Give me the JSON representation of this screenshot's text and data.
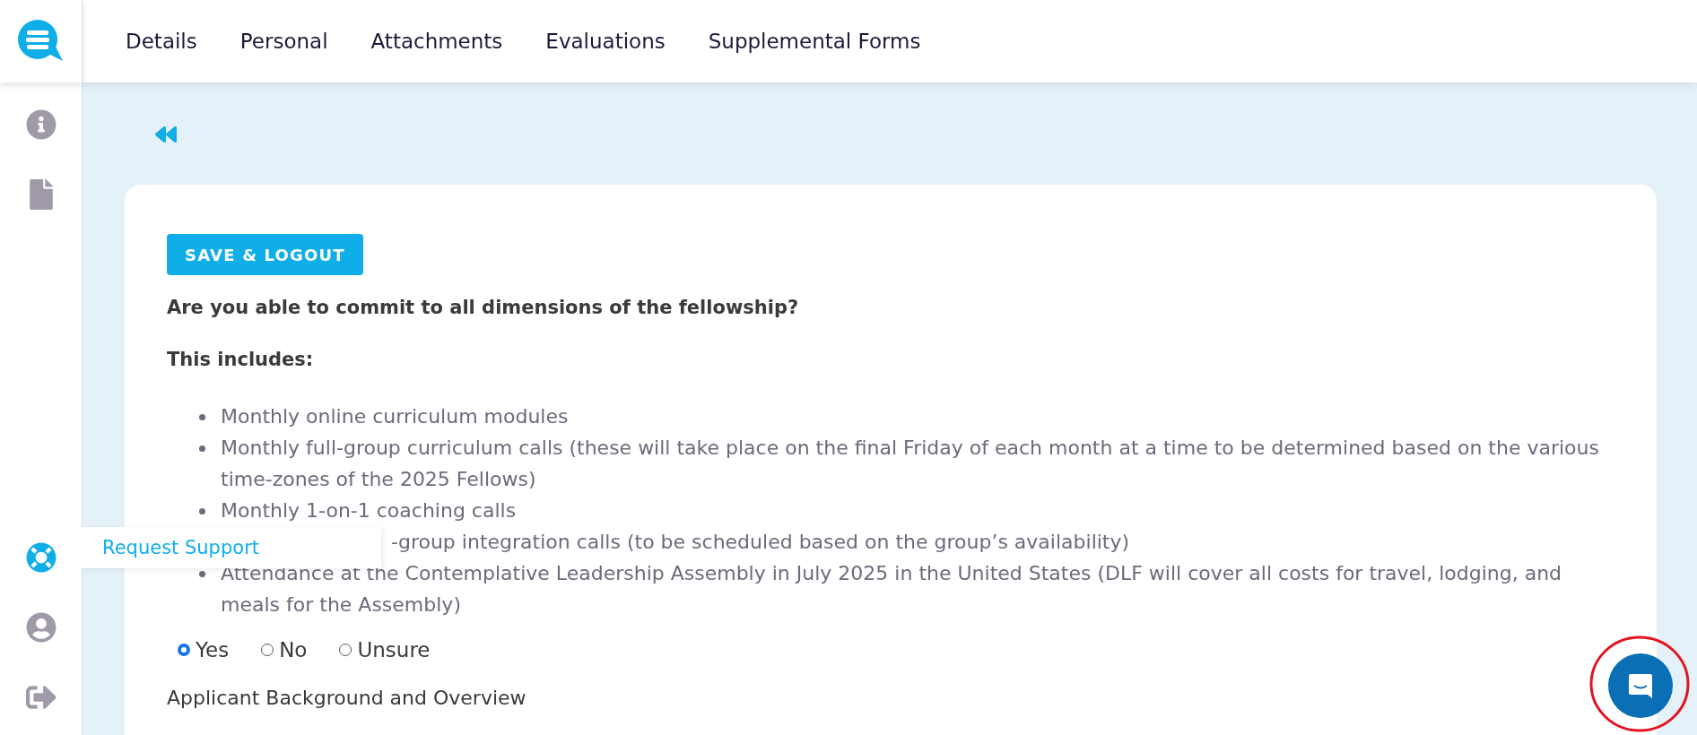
{
  "sidebar": {
    "items": [
      {
        "kind": "info",
        "selected": false
      },
      {
        "kind": "document",
        "selected": false
      },
      {
        "kind": "support",
        "selected": true
      },
      {
        "kind": "profile",
        "selected": false
      },
      {
        "kind": "logout",
        "selected": false
      }
    ],
    "tooltip": "Request Support"
  },
  "tabs": [
    "Details",
    "Personal",
    "Attachments",
    "Evaluations",
    "Supplemental Forms"
  ],
  "form": {
    "save_button": "SAVE & LOGOUT",
    "question": "Are you able to commit to all dimensions of the fellowship?",
    "includes_heading": "This includes:",
    "items": [
      {
        "kind": "bullet",
        "text": "Monthly online curriculum modules"
      },
      {
        "kind": "bullet",
        "text": "Monthly full-group curriculum calls (these will take place on the final Friday of each month at a time to be determined based on the various time-zones of the 2025 Fellows)"
      },
      {
        "kind": "bullet",
        "text": "Monthly 1-on-1 coaching calls"
      },
      {
        "kind": "covered",
        "text": "-group integration calls (to be scheduled based on the group’s availability)"
      },
      {
        "kind": "bullet",
        "text": "Attendance at the Contemplative Leadership Assembly in July 2025 in the United States (DLF will cover all costs for travel, lodging, and meals for the Assembly)"
      }
    ],
    "options": [
      {
        "label": "Yes",
        "selected": true
      },
      {
        "label": "No",
        "selected": false
      },
      {
        "label": "Unsure",
        "selected": false
      }
    ],
    "next_heading": "Applicant Background and Overview"
  }
}
